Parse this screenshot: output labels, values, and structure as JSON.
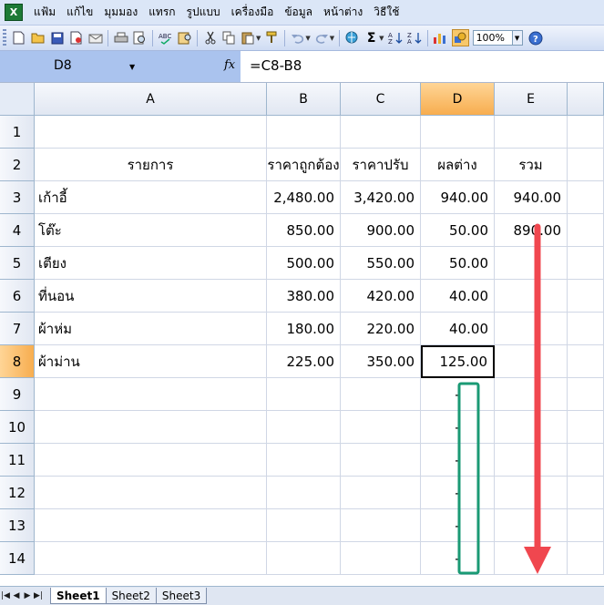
{
  "menu": [
    "แฟ้ม",
    "แก้ไข",
    "มุมมอง",
    "แทรก",
    "รูปแบบ",
    "เครื่องมือ",
    "ข้อมูล",
    "หน้าต่าง",
    "วิธีใช้"
  ],
  "toolbar": {
    "zoom": "100%",
    "icons": [
      "new-icon",
      "open-icon",
      "save-icon",
      "permission-icon",
      "email-icon",
      "print-icon",
      "print-preview-icon",
      "spelling-icon",
      "research-icon",
      "cut-icon",
      "copy-icon",
      "paste-icon",
      "format-painter-icon",
      "undo-icon",
      "redo-icon",
      "hyperlink-icon",
      "autosum-icon",
      "sort-ascending-icon",
      "sort-descending-icon",
      "chart-wizard-icon",
      "drawing-icon",
      "help-icon"
    ]
  },
  "formula_bar": {
    "name_box": "D8",
    "fx": "fx",
    "formula": "=C8-B8"
  },
  "columns": [
    "A",
    "B",
    "C",
    "D",
    "E"
  ],
  "rows": [
    {
      "num": "1",
      "a": "",
      "b": "",
      "c": "",
      "d": "",
      "e": ""
    },
    {
      "num": "2",
      "a": "รายการ",
      "b": "ราคาถูกต้อง",
      "c": "ราคาปรับ",
      "d": "ผลต่าง",
      "e": "รวม"
    },
    {
      "num": "3",
      "a": "เก้าอี้",
      "b": "2,480.00",
      "c": "3,420.00",
      "d": "940.00",
      "e": "940.00"
    },
    {
      "num": "4",
      "a": "โต๊ะ",
      "b": "850.00",
      "c": "900.00",
      "d": "50.00",
      "e": "890.00"
    },
    {
      "num": "5",
      "a": "เตียง",
      "b": "500.00",
      "c": "550.00",
      "d": "50.00",
      "e": ""
    },
    {
      "num": "6",
      "a": "ที่นอน",
      "b": "380.00",
      "c": "420.00",
      "d": "40.00",
      "e": ""
    },
    {
      "num": "7",
      "a": "ผ้าห่ม",
      "b": "180.00",
      "c": "220.00",
      "d": "40.00",
      "e": ""
    },
    {
      "num": "8",
      "a": "ผ้าม่าน",
      "b": "225.00",
      "c": "350.00",
      "d": "125.00",
      "e": ""
    },
    {
      "num": "9",
      "a": "",
      "b": "",
      "c": "",
      "d": "-",
      "e": ""
    },
    {
      "num": "10",
      "a": "",
      "b": "",
      "c": "",
      "d": "-",
      "e": ""
    },
    {
      "num": "11",
      "a": "",
      "b": "",
      "c": "",
      "d": "-",
      "e": ""
    },
    {
      "num": "12",
      "a": "",
      "b": "",
      "c": "",
      "d": "-",
      "e": ""
    },
    {
      "num": "13",
      "a": "",
      "b": "",
      "c": "",
      "d": "-",
      "e": ""
    },
    {
      "num": "14",
      "a": "",
      "b": "",
      "c": "",
      "d": "-",
      "e": ""
    }
  ],
  "sheet_tabs": [
    "Sheet1",
    "Sheet2",
    "Sheet3"
  ],
  "active_sheet": "Sheet1",
  "selected_cell": "D8",
  "colors": {
    "highlight_box": "#1a9a74",
    "arrow": "#f0474f",
    "selected_header": "#f7ad4f"
  }
}
